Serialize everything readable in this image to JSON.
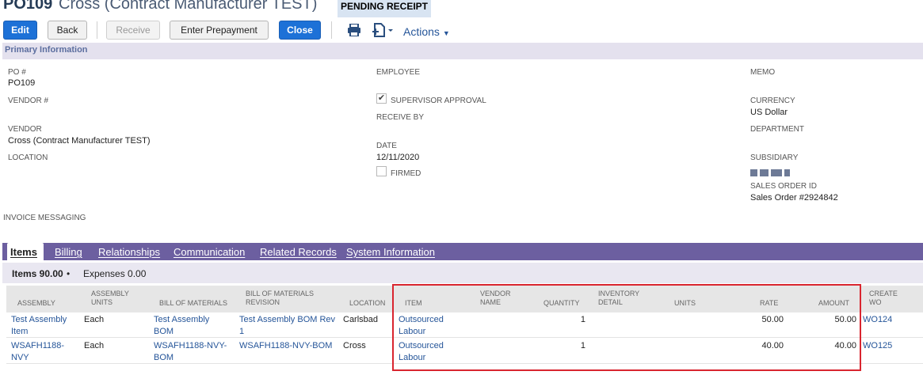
{
  "header": {
    "po_number": "PO109",
    "vendor_name": "Cross (Contract Manufacturer TEST)",
    "status": "PENDING RECEIPT"
  },
  "toolbar": {
    "edit": "Edit",
    "back": "Back",
    "receive": "Receive",
    "enter_prepayment": "Enter Prepayment",
    "close": "Close",
    "actions": "Actions"
  },
  "primary": {
    "section_title": "Primary Information",
    "po_label": "PO #",
    "po_value": "PO109",
    "vendor_num_label": "VENDOR #",
    "vendor_label": "VENDOR",
    "vendor_value": "Cross (Contract Manufacturer TEST)",
    "location_label": "LOCATION",
    "employee_label": "EMPLOYEE",
    "supervisor_label": "SUPERVISOR APPROVAL",
    "supervisor_checked": "✔",
    "receive_by_label": "RECEIVE BY",
    "date_label": "DATE",
    "date_value": "12/11/2020",
    "firmed_label": "FIRMED",
    "memo_label": "MEMO",
    "currency_label": "CURRENCY",
    "currency_value": "US Dollar",
    "department_label": "DEPARTMENT",
    "subsidiary_label": "SUBSIDIARY",
    "sales_order_label": "SALES ORDER ID",
    "sales_order_value": "Sales Order #2924842",
    "invoice_messaging_label": "INVOICE MESSAGING"
  },
  "tabs": [
    "Items",
    "Billing",
    "Relationships",
    "Communication",
    "Related Records",
    "System Information"
  ],
  "subtabs": {
    "items": "Items 90.00",
    "bullet": "•",
    "expenses": "Expenses 0.00"
  },
  "table": {
    "headers": {
      "assembly": "ASSEMBLY",
      "assembly_units_1": "ASSEMBLY",
      "assembly_units_2": "UNITS",
      "bom": "BILL OF MATERIALS",
      "bom_rev_1": "BILL OF MATERIALS",
      "bom_rev_2": "REVISION",
      "location": "LOCATION",
      "item": "ITEM",
      "vendor_name_1": "VENDOR",
      "vendor_name_2": "NAME",
      "quantity": "QUANTITY",
      "inv_detail_1": "INVENTORY",
      "inv_detail_2": "DETAIL",
      "units": "UNITS",
      "rate": "RATE",
      "amount": "AMOUNT",
      "create_wo_1": "CREATE",
      "create_wo_2": "WO"
    },
    "rows": [
      {
        "assembly_1": "Test Assembly",
        "assembly_2": "Item",
        "units": "Each",
        "bom_1": "Test Assembly",
        "bom_2": "BOM",
        "bom_rev_1": "Test Assembly BOM Rev",
        "bom_rev_2": "1",
        "location": "Carlsbad",
        "item_1": "Outsourced",
        "item_2": "Labour",
        "quantity": "1",
        "rate": "50.00",
        "amount": "50.00",
        "wo": "WO124"
      },
      {
        "assembly_1": "WSAFH1188-",
        "assembly_2": "NVY",
        "units": "Each",
        "bom_1": "WSAFH1188-NVY-",
        "bom_2": "BOM",
        "bom_rev_1": "WSAFH1188-NVY-BOM",
        "bom_rev_2": "",
        "location": "Cross",
        "item_1": "Outsourced",
        "item_2": "Labour",
        "quantity": "1",
        "rate": "40.00",
        "amount": "40.00",
        "wo": "WO125"
      }
    ]
  },
  "colors": {
    "primary_button": "#1d71d7",
    "tab_bar": "#6c5fa0",
    "section_bar": "#e4e1ee",
    "highlight_box": "#d9252f",
    "link": "#255599"
  }
}
